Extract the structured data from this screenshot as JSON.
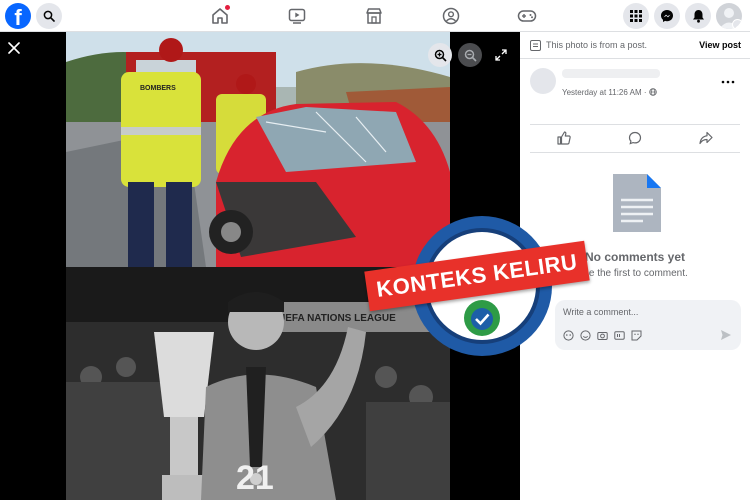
{
  "topbar": {
    "logo_letter": "f",
    "nav_icons": [
      "home-icon",
      "video-icon",
      "marketplace-icon",
      "groups-icon",
      "gaming-icon"
    ],
    "right_icons": [
      "menu-grid-icon",
      "messenger-icon",
      "notifications-icon",
      "account-icon"
    ],
    "brand_color": "#0866ff"
  },
  "viewer": {
    "background": "#000000",
    "controls": [
      "close-icon",
      "zoom-in-icon",
      "zoom-out-icon",
      "fullscreen-icon"
    ],
    "photo_top_text": "BOMBERS",
    "photo_bottom_banner_text": "UEFA NATIONS LEAGUE",
    "photo_bottom_shirt_number": "21"
  },
  "stamp": {
    "label": "KONTEKS KELIRU",
    "banner_color": "#e8312a",
    "ring_color": "#1f5aa6"
  },
  "panel": {
    "post_notice": "This photo is from a post.",
    "view_post": "View post",
    "timestamp": "Yesterday at 11:26 AM · ",
    "no_comments_title": "No comments yet",
    "no_comments_sub": "Be the first to comment.",
    "comment_placeholder": "Write a comment..."
  }
}
